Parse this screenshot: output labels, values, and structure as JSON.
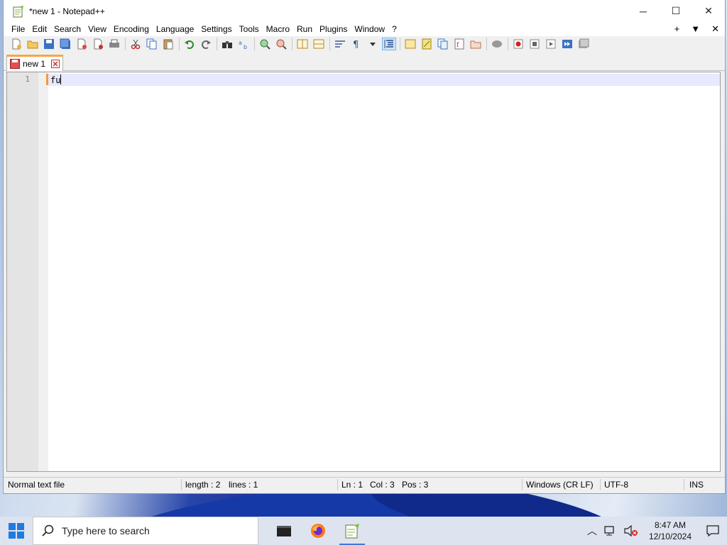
{
  "window": {
    "title": "*new 1 - Notepad++",
    "minimize": "─",
    "maximize": "☐",
    "close": "✕"
  },
  "menu": [
    "File",
    "Edit",
    "Search",
    "View",
    "Encoding",
    "Language",
    "Settings",
    "Tools",
    "Macro",
    "Run",
    "Plugins",
    "Window",
    "?"
  ],
  "menu_right": {
    "add": "+",
    "dropdown": "▼",
    "close": "✕"
  },
  "tabs": [
    {
      "label": "new 1"
    }
  ],
  "editor": {
    "line_numbers": [
      "1"
    ],
    "lines": [
      "fu"
    ]
  },
  "status": {
    "file_type": "Normal text file",
    "length": "length : 2",
    "lines": "lines : 1",
    "ln": "Ln : 1",
    "col": "Col : 3",
    "pos": "Pos : 3",
    "eol": "Windows (CR LF)",
    "encoding": "UTF-8",
    "mode": "INS"
  },
  "taskbar": {
    "search_placeholder": "Type here to search",
    "time": "8:47 AM",
    "date": "12/10/2024"
  },
  "colors": {
    "tab_accent": "#f7a44a",
    "current_line": "#e8e8ff",
    "taskbar": "#dde4ef"
  }
}
